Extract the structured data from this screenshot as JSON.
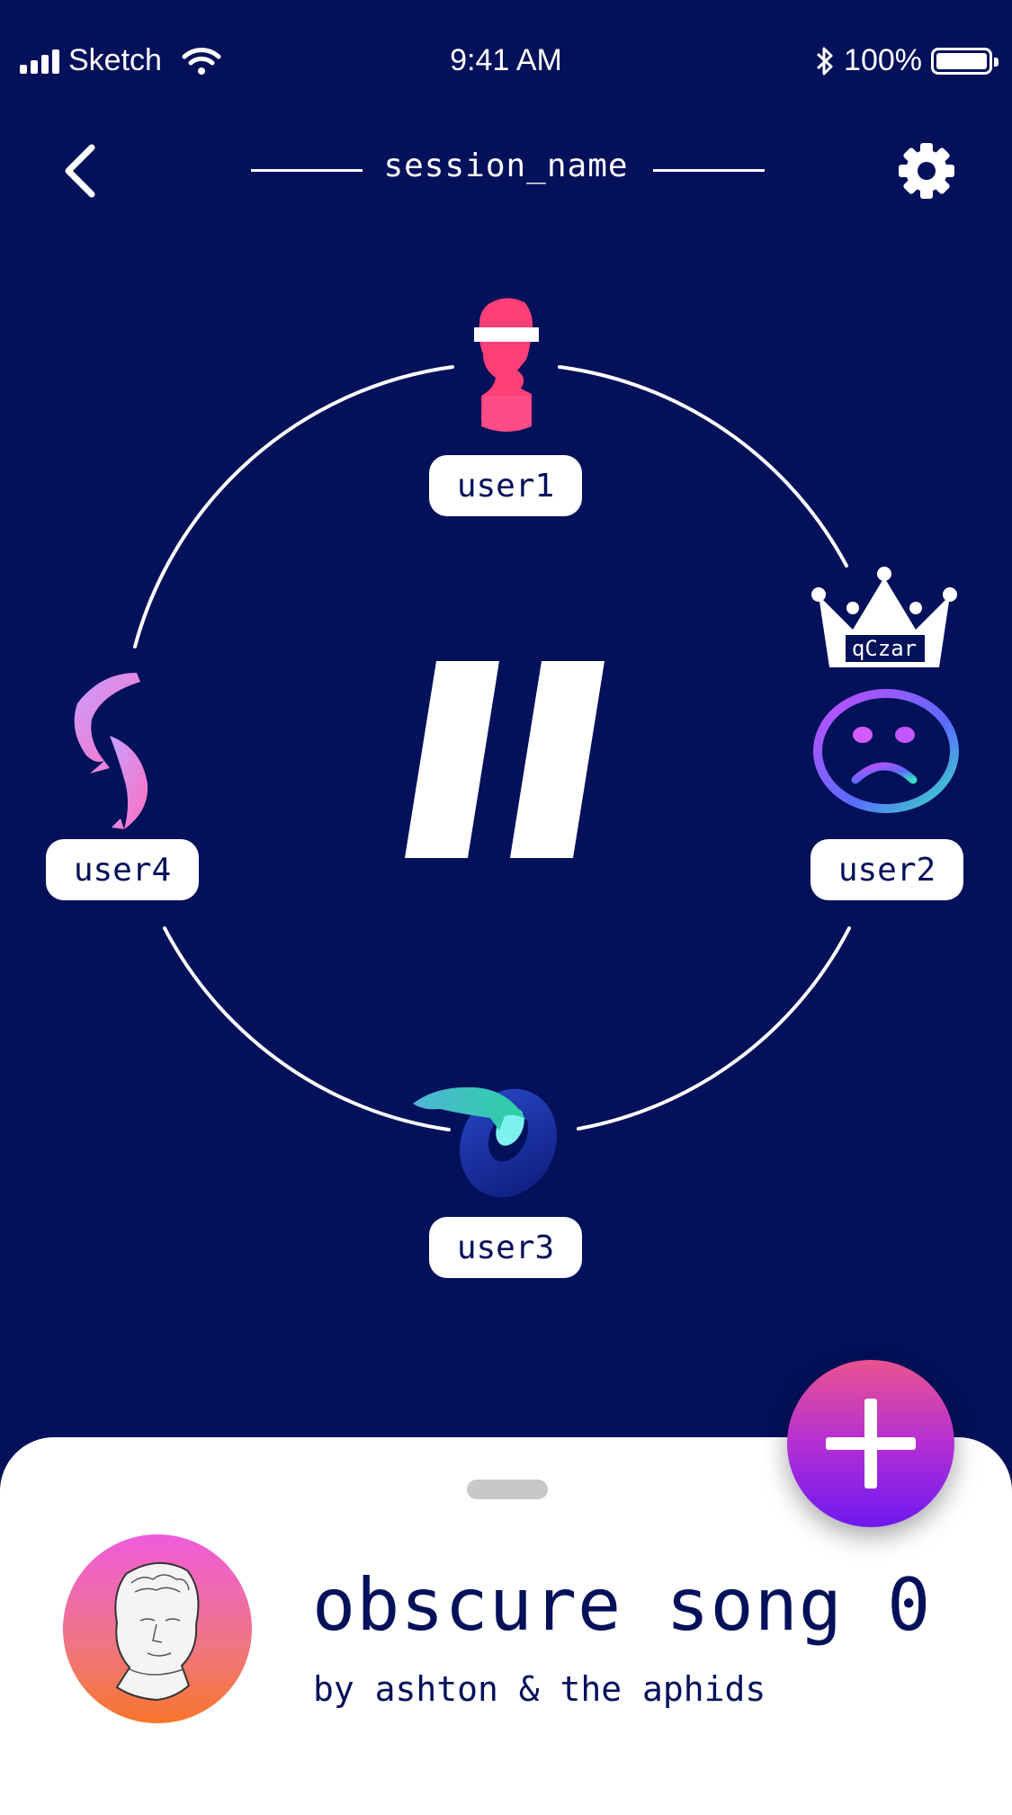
{
  "status_bar": {
    "carrier": "Sketch",
    "time": "9:41 AM",
    "battery_percent": "100%"
  },
  "header": {
    "title": "session_name"
  },
  "session": {
    "center_glyph": "//",
    "users": [
      {
        "label": "user1",
        "avatar": "statue-bust-icon"
      },
      {
        "label": "user2",
        "avatar": "sad-face-icon",
        "badge": "qCzar"
      },
      {
        "label": "user3",
        "avatar": "dolphin-torus-icon"
      },
      {
        "label": "user4",
        "avatar": "koi-fish-icon"
      }
    ]
  },
  "now_playing": {
    "title": "obscure song 0",
    "artist": "by ashton & the aphids"
  },
  "colors": {
    "background": "#03105a",
    "sheet": "#ffffff",
    "text_dark": "#03105a",
    "fab_top": "#ea5391",
    "fab_bottom": "#6e18f2"
  }
}
